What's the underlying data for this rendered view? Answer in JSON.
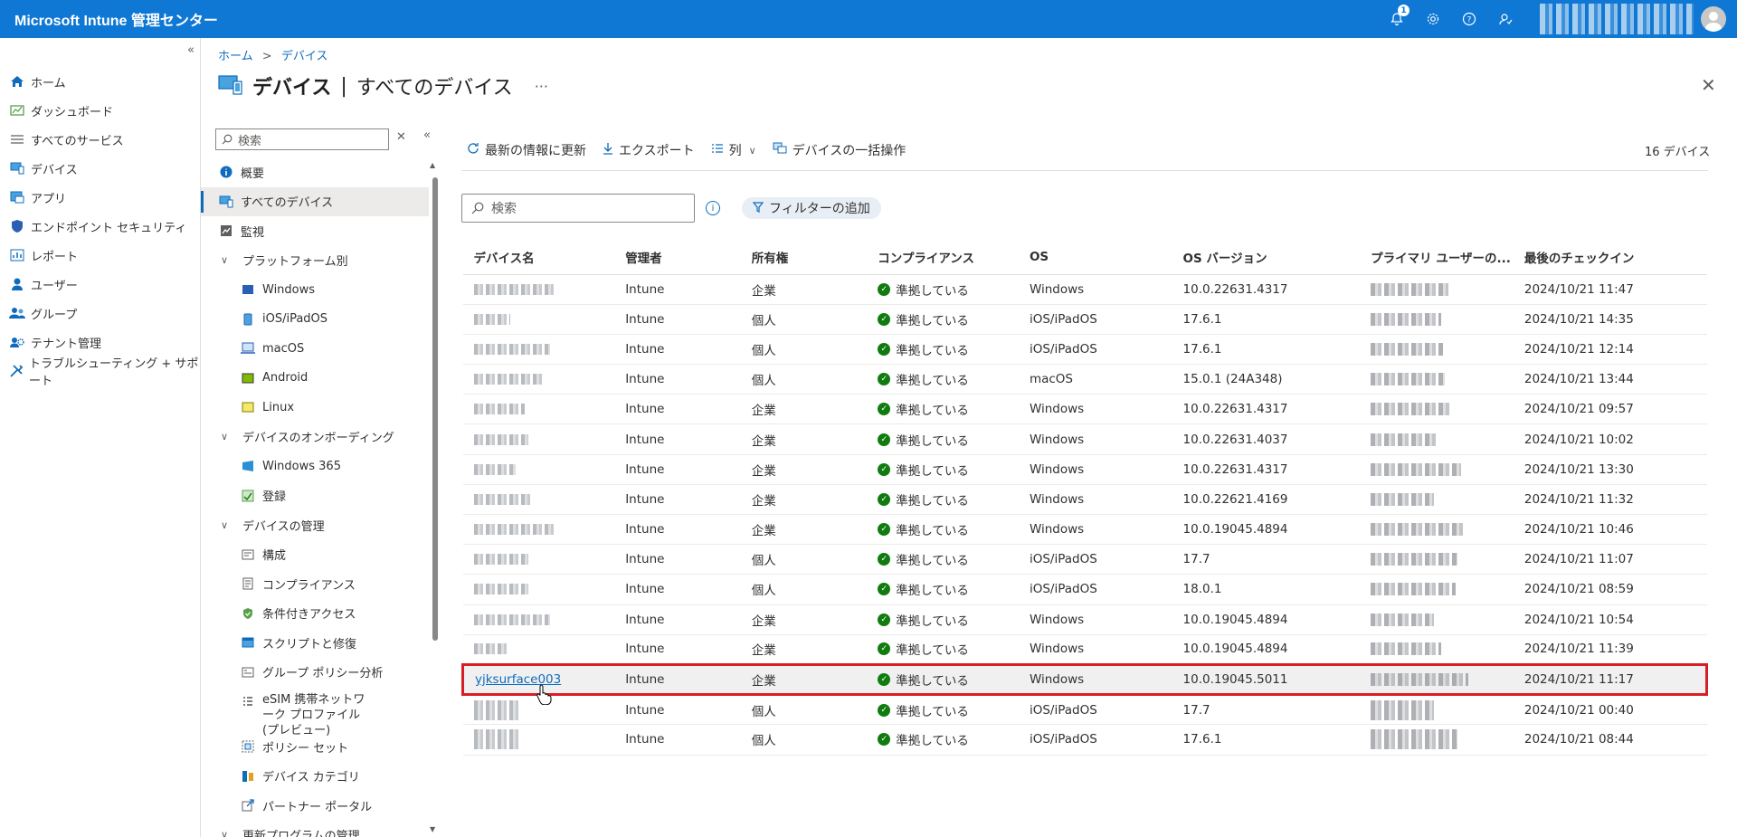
{
  "app": {
    "title": "Microsoft Intune 管理センター",
    "notification_count": "1"
  },
  "leftnav": {
    "items": [
      {
        "label": "ホーム",
        "icon": "home-icon"
      },
      {
        "label": "ダッシュボード",
        "icon": "dashboard-icon"
      },
      {
        "label": "すべてのサービス",
        "icon": "list-icon"
      },
      {
        "label": "デバイス",
        "icon": "devices-icon"
      },
      {
        "label": "アプリ",
        "icon": "apps-icon"
      },
      {
        "label": "エンドポイント セキュリティ",
        "icon": "shield-icon"
      },
      {
        "label": "レポート",
        "icon": "report-icon"
      },
      {
        "label": "ユーザー",
        "icon": "user-icon"
      },
      {
        "label": "グループ",
        "icon": "group-icon"
      },
      {
        "label": "テナント管理",
        "icon": "tenant-icon"
      },
      {
        "label": "トラブルシューティング + サポート",
        "icon": "wrench-icon"
      }
    ]
  },
  "breadcrumb": {
    "home": "ホーム",
    "current": "デバイス",
    "separator": ">"
  },
  "header": {
    "title": "デバイス",
    "divider": "|",
    "subtitle": "すべてのデバイス",
    "more": "···",
    "close": "✕"
  },
  "resmenu": {
    "search_placeholder": "検索",
    "items": [
      {
        "label": "概要"
      },
      {
        "label": "すべてのデバイス"
      },
      {
        "label": "監視"
      },
      {
        "label": "プラットフォーム別"
      },
      {
        "label": "Windows"
      },
      {
        "label": "iOS/iPadOS"
      },
      {
        "label": "macOS"
      },
      {
        "label": "Android"
      },
      {
        "label": "Linux"
      },
      {
        "label": "デバイスのオンボーディング"
      },
      {
        "label": "Windows 365"
      },
      {
        "label": "登録"
      },
      {
        "label": "デバイスの管理"
      },
      {
        "label": "構成"
      },
      {
        "label": "コンプライアンス"
      },
      {
        "label": "条件付きアクセス"
      },
      {
        "label": "スクリプトと修復"
      },
      {
        "label": "グループ ポリシー分析"
      },
      {
        "label": "eSIM 携帯ネットワーク プロファイル (プレビュー)"
      },
      {
        "label": "ポリシー セット"
      },
      {
        "label": "デバイス カテゴリ"
      },
      {
        "label": "パートナー ポータル"
      },
      {
        "label": "更新プログラムの管理"
      }
    ]
  },
  "toolbar": {
    "refresh": "最新の情報に更新",
    "export": "エクスポート",
    "columns": "列",
    "bulk": "デバイスの一括操作",
    "count": "16 デバイス"
  },
  "filter": {
    "search_placeholder": "検索",
    "add_filter": "フィルターの追加"
  },
  "table": {
    "headers": [
      "デバイス名",
      "管理者",
      "所有権",
      "コンプライアンス",
      "OS",
      "OS バージョン",
      "プライマリ ユーザーの...",
      "最後のチェックイン"
    ],
    "rows": [
      {
        "managed": "Intune",
        "owner": "企業",
        "compliance": "準拠している",
        "os": "Windows",
        "ver": "10.0.22631.4317",
        "checkin": "2024/10/21 11:47"
      },
      {
        "managed": "Intune",
        "owner": "個人",
        "compliance": "準拠している",
        "os": "iOS/iPadOS",
        "ver": "17.6.1",
        "checkin": "2024/10/21 14:35"
      },
      {
        "managed": "Intune",
        "owner": "個人",
        "compliance": "準拠している",
        "os": "iOS/iPadOS",
        "ver": "17.6.1",
        "checkin": "2024/10/21 12:14"
      },
      {
        "managed": "Intune",
        "owner": "個人",
        "compliance": "準拠している",
        "os": "macOS",
        "ver": "15.0.1 (24A348)",
        "checkin": "2024/10/21 13:44"
      },
      {
        "managed": "Intune",
        "owner": "企業",
        "compliance": "準拠している",
        "os": "Windows",
        "ver": "10.0.22631.4317",
        "checkin": "2024/10/21 09:57"
      },
      {
        "managed": "Intune",
        "owner": "企業",
        "compliance": "準拠している",
        "os": "Windows",
        "ver": "10.0.22631.4037",
        "checkin": "2024/10/21 10:02"
      },
      {
        "managed": "Intune",
        "owner": "企業",
        "compliance": "準拠している",
        "os": "Windows",
        "ver": "10.0.22631.4317",
        "checkin": "2024/10/21 13:30"
      },
      {
        "managed": "Intune",
        "owner": "企業",
        "compliance": "準拠している",
        "os": "Windows",
        "ver": "10.0.22621.4169",
        "checkin": "2024/10/21 11:32"
      },
      {
        "managed": "Intune",
        "owner": "企業",
        "compliance": "準拠している",
        "os": "Windows",
        "ver": "10.0.19045.4894",
        "checkin": "2024/10/21 10:46"
      },
      {
        "managed": "Intune",
        "owner": "個人",
        "compliance": "準拠している",
        "os": "iOS/iPadOS",
        "ver": "17.7",
        "checkin": "2024/10/21 11:07"
      },
      {
        "managed": "Intune",
        "owner": "個人",
        "compliance": "準拠している",
        "os": "iOS/iPadOS",
        "ver": "18.0.1",
        "checkin": "2024/10/21 08:59"
      },
      {
        "managed": "Intune",
        "owner": "企業",
        "compliance": "準拠している",
        "os": "Windows",
        "ver": "10.0.19045.4894",
        "checkin": "2024/10/21 10:54"
      },
      {
        "managed": "Intune",
        "owner": "企業",
        "compliance": "準拠している",
        "os": "Windows",
        "ver": "10.0.19045.4894",
        "checkin": "2024/10/21 11:39"
      },
      {
        "name": "yjksurface003",
        "managed": "Intune",
        "owner": "企業",
        "compliance": "準拠している",
        "os": "Windows",
        "ver": "10.0.19045.5011",
        "checkin": "2024/10/21 11:17"
      },
      {
        "managed": "Intune",
        "owner": "個人",
        "compliance": "準拠している",
        "os": "iOS/iPadOS",
        "ver": "17.7",
        "checkin": "2024/10/21 00:40"
      },
      {
        "managed": "Intune",
        "owner": "個人",
        "compliance": "準拠している",
        "os": "iOS/iPadOS",
        "ver": "17.6.1",
        "checkin": "2024/10/21 08:44"
      }
    ]
  },
  "colors": {
    "topbar": "#0f78d4",
    "accent": "#0f6cbd",
    "highlight_border": "#d81e25",
    "compliant": "#107c10"
  }
}
